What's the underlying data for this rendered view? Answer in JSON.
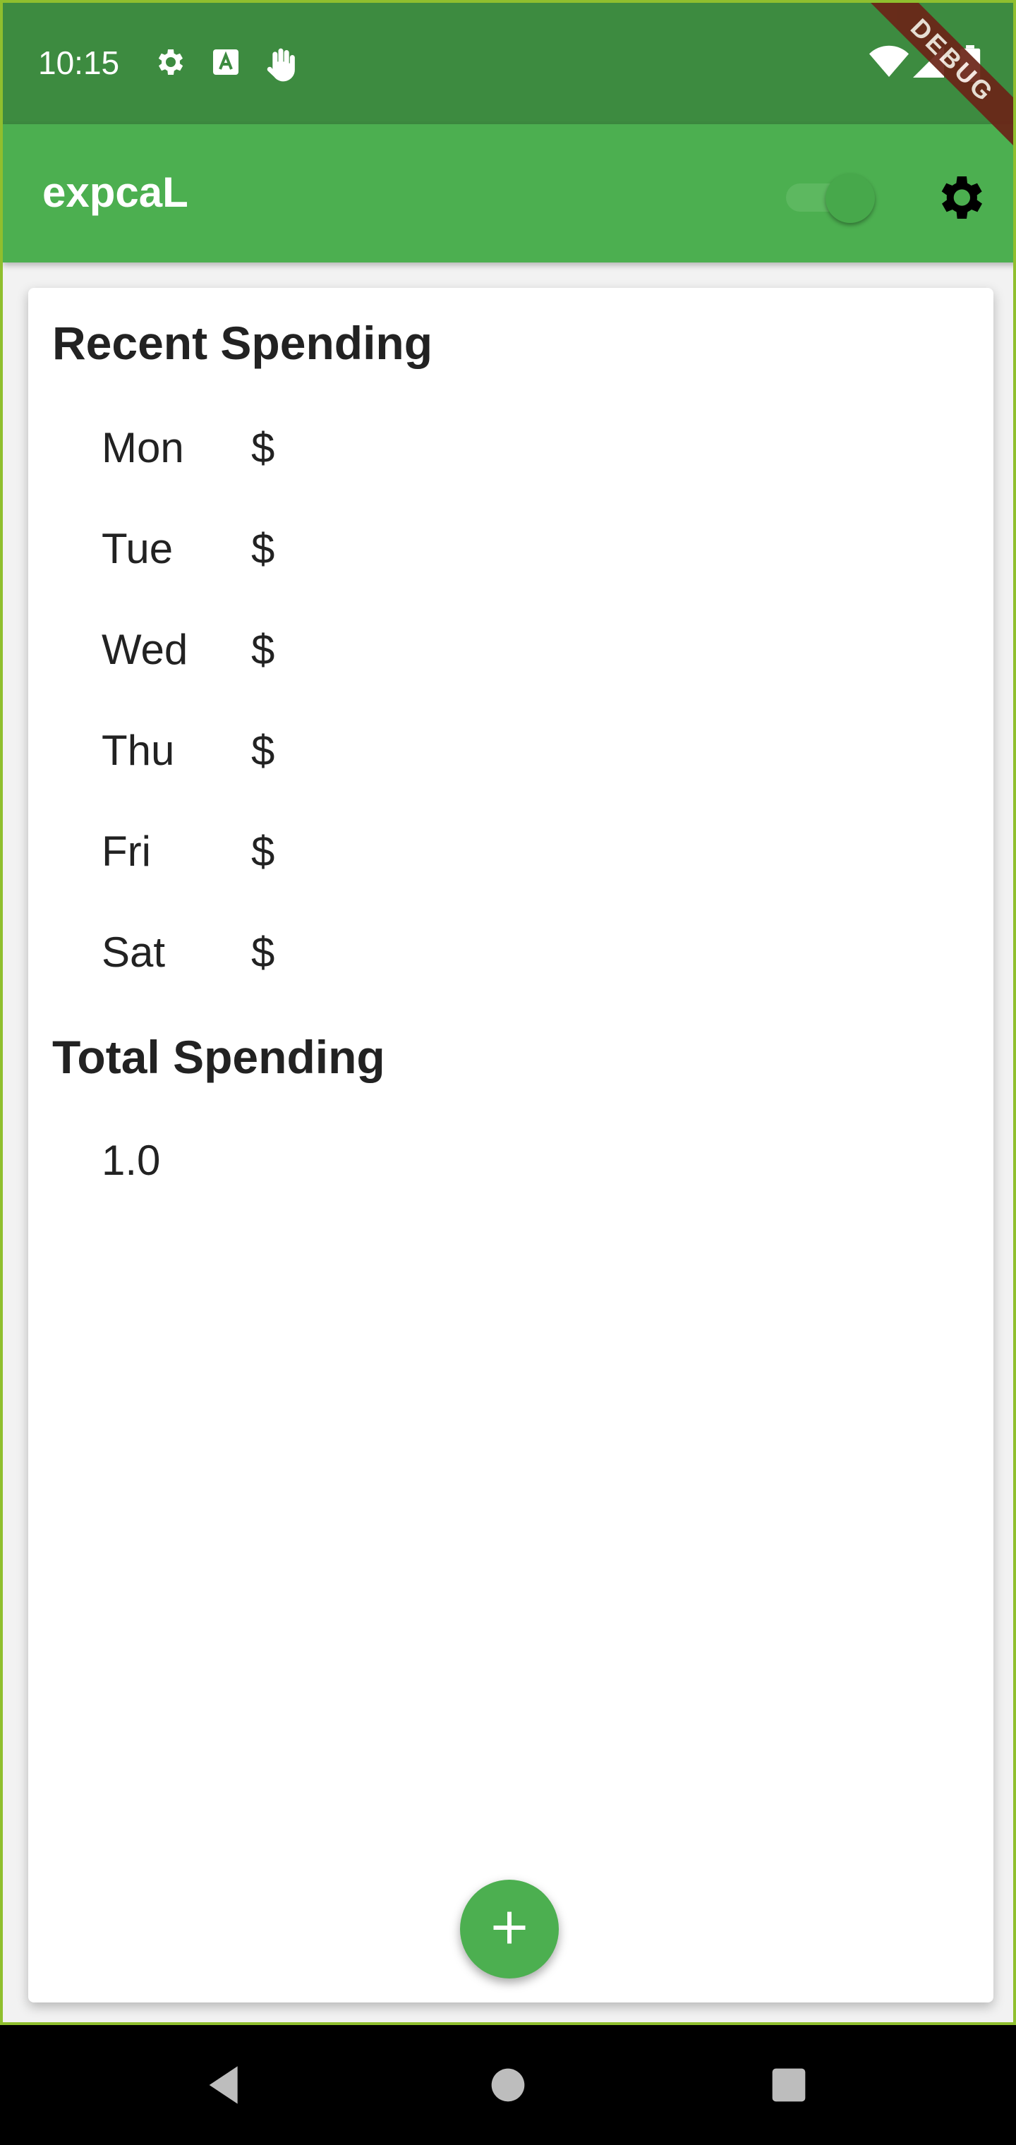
{
  "status_bar": {
    "time": "10:15",
    "left_icons": [
      "gear-icon",
      "a-box-icon",
      "hand-wave-icon"
    ],
    "right_icons": [
      "wifi-icon",
      "signal-icon",
      "battery-icon"
    ]
  },
  "app_bar": {
    "title": "expcaL",
    "toggle_on": true,
    "settings_icon": "gear-icon"
  },
  "debug_banner": "DEBUG",
  "recent": {
    "title": "Recent Spending",
    "days": [
      {
        "label": "Mon",
        "amount": "$"
      },
      {
        "label": "Tue",
        "amount": "$"
      },
      {
        "label": "Wed",
        "amount": "$"
      },
      {
        "label": "Thu",
        "amount": "$"
      },
      {
        "label": "Fri",
        "amount": "$"
      },
      {
        "label": "Sat",
        "amount": "$"
      }
    ]
  },
  "total": {
    "title": "Total Spending",
    "value": "1.0"
  },
  "fab_icon": "plus-icon",
  "nav": [
    "back-icon",
    "home-icon",
    "recents-icon"
  ],
  "colors": {
    "status_bar": "#3d8b40",
    "app_bar": "#4caf50",
    "fab": "#4caf50",
    "debug": "#6b2417"
  }
}
